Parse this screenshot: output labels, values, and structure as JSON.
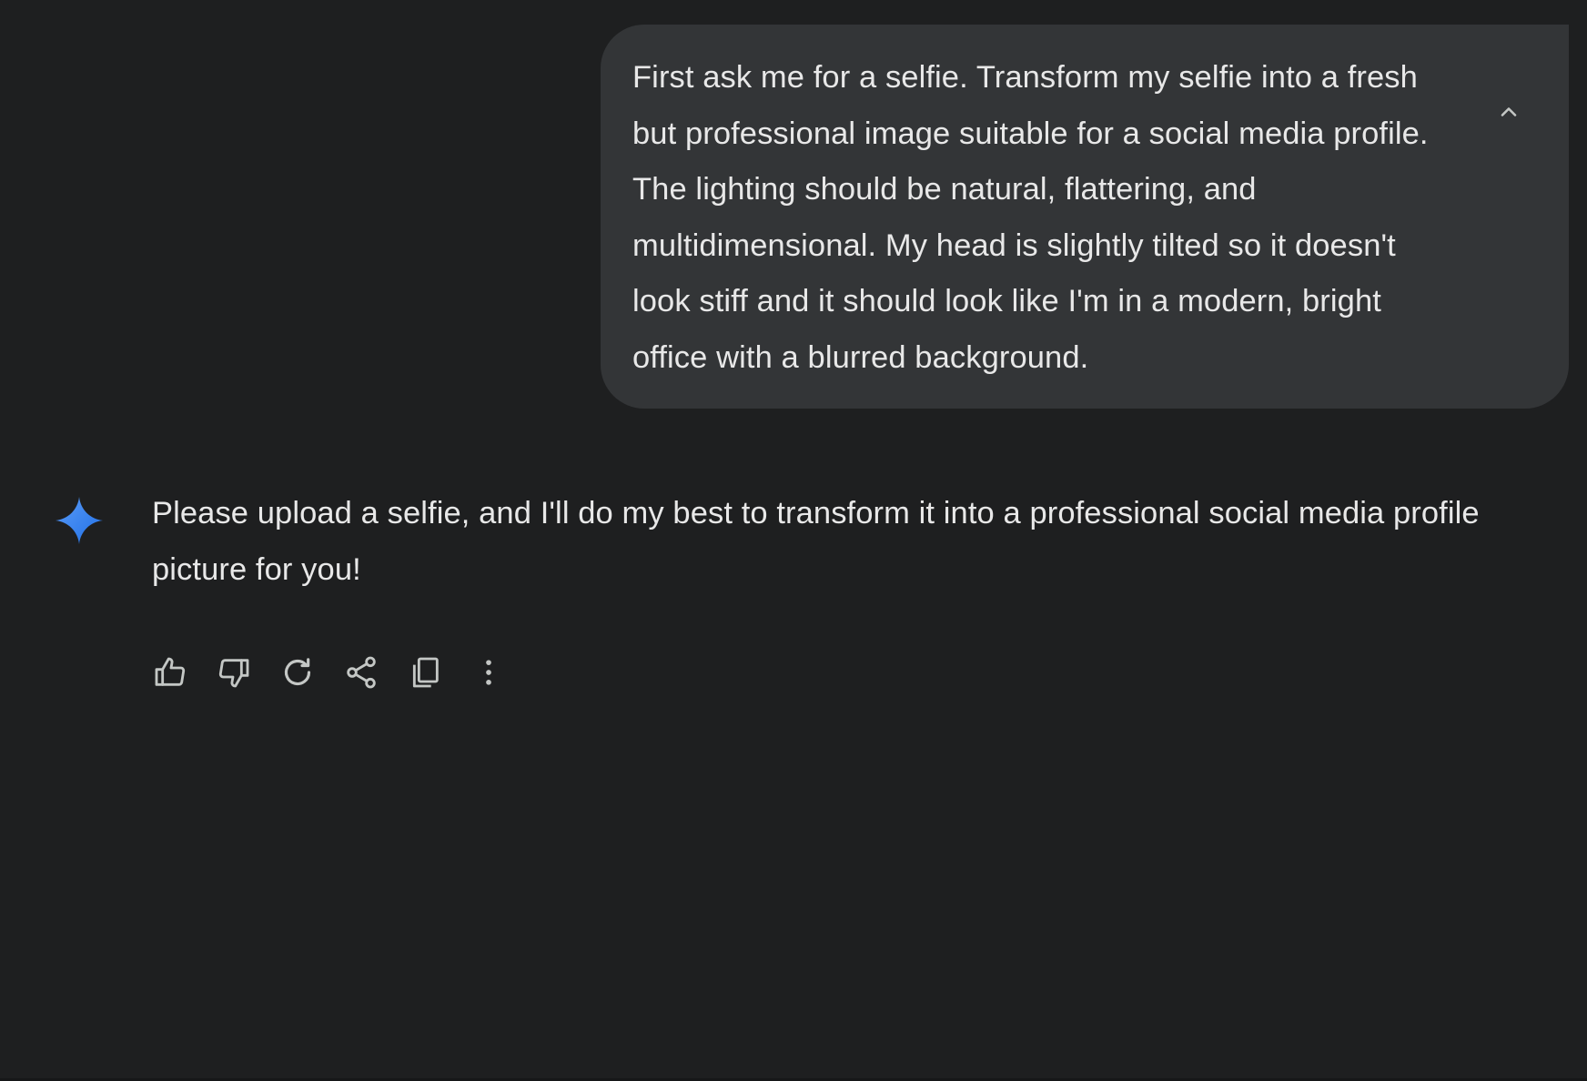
{
  "conversation": {
    "user_message": {
      "text": "First ask me for a selfie. Transform my selfie into a fresh but professional image suitable for a social media profile. The lighting should be natural, flattering, and multidimensional. My head is slightly tilted so it doesn't look stiff and it should look like I'm in a modern, bright office with a blurred background.",
      "collapse_icon": "chevron-up-icon"
    },
    "assistant_response": {
      "text": "Please upload a selfie, and I'll do my best to transform it into a professional social media profile picture for you!",
      "avatar_icon": "gemini-sparkle-icon"
    },
    "response_actions": [
      {
        "name": "thumbs-up",
        "icon": "thumbs-up-icon"
      },
      {
        "name": "thumbs-down",
        "icon": "thumbs-down-icon"
      },
      {
        "name": "regenerate",
        "icon": "refresh-icon"
      },
      {
        "name": "share",
        "icon": "share-icon"
      },
      {
        "name": "copy",
        "icon": "copy-icon"
      },
      {
        "name": "more-options",
        "icon": "more-vert-icon"
      }
    ]
  },
  "colors": {
    "background": "#1e1f20",
    "user_bubble": "#333537",
    "text": "#e8e8e8",
    "icon": "#c4c7c5",
    "sparkle_start": "#4f8ff7",
    "sparkle_end": "#1a73e8"
  }
}
